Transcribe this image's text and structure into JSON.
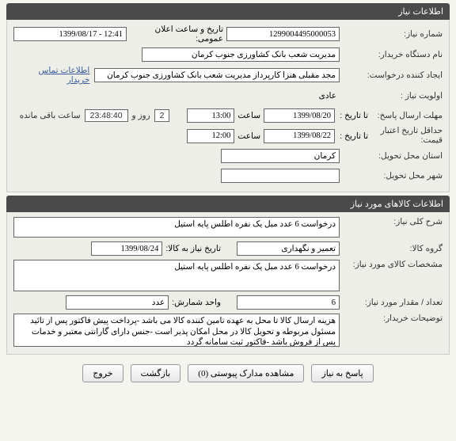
{
  "panel1": {
    "title": "اطلاعات نیاز",
    "needNumberLabel": "شماره نیاز:",
    "needNumber": "1299004495000053",
    "announceLabel": "تاریخ و ساعت اعلان عمومی:",
    "announceValue": "12:41 - 1399/08/17",
    "orgLabel": "نام دستگاه خریدار:",
    "orgValue": "مدیریت شعب بانک کشاورزی جنوب کرمان",
    "creatorLabel": "ایجاد کننده درخواست:",
    "creatorValue": "مجد مقبلی هنزا کارپرداز مدیریت شعب بانک کشاورزی جنوب کرمان",
    "contactLink": "اطلاعات تماس خریدار",
    "priorityLabel": "اولویت نیاز :",
    "priorityValue": "عادی",
    "deadlineLabel": "مهلت ارسال پاسخ:",
    "toDateLabel": "تا تاریخ :",
    "deadlineDate": "1399/08/20",
    "timeLabel": "ساعت",
    "deadlineTime": "13:00",
    "remainingDaysLabel": "روز و",
    "remainingDays": "2",
    "remainingTime": "23:48:40",
    "remainingSuffix": "ساعت باقی مانده",
    "minValidityLabel": "حداقل تاریخ اعتبار قیمت:",
    "validityDate": "1399/08/22",
    "validityTime": "12:00",
    "provinceLabel": "استان محل تحویل:",
    "provinceValue": "کرمان",
    "cityLabel": "شهر محل تحویل:",
    "cityValue": ""
  },
  "panel2": {
    "title": "اطلاعات کالاهای مورد نیاز",
    "generalDescLabel": "شرح کلی نیاز:",
    "generalDesc": "درخواست 6 عدد مبل یک نفره اطلس پایه استیل",
    "groupLabel": "گروه کالا:",
    "groupValue": "تعمیر و نگهداری",
    "needByLabel": "تاریخ نیاز به کالا:",
    "needByDate": "1399/08/24",
    "specLabel": "مشخصات کالای مورد نیاز:",
    "specValue": "درخواست 6 عدد مبل یک نفره اطلس پایه استیل",
    "qtyLabel": "تعداد / مقدار مورد نیاز:",
    "qtyValue": "6",
    "unitLabel": "واحد شمارش:",
    "unitValue": "عدد",
    "notesLabel": "توضیحات خریدار:",
    "notesValue": "هزینه ارسال کالا تا محل به عهده تامین کننده کالا می باشد -پرداخت پیش فاکتور پس از تائید مسئول مربوطه و تحویل کالا در محل امکان پذیر است -جنس دارای گارانتی معتبر و خدمات پس از فروش باشد -فاکتور ثبت سامانه گردد"
  },
  "buttons": {
    "respond": "پاسخ به نیاز",
    "attachments": "مشاهده مدارک پیوستی (0)",
    "back": "بازگشت",
    "exit": "خروج"
  }
}
